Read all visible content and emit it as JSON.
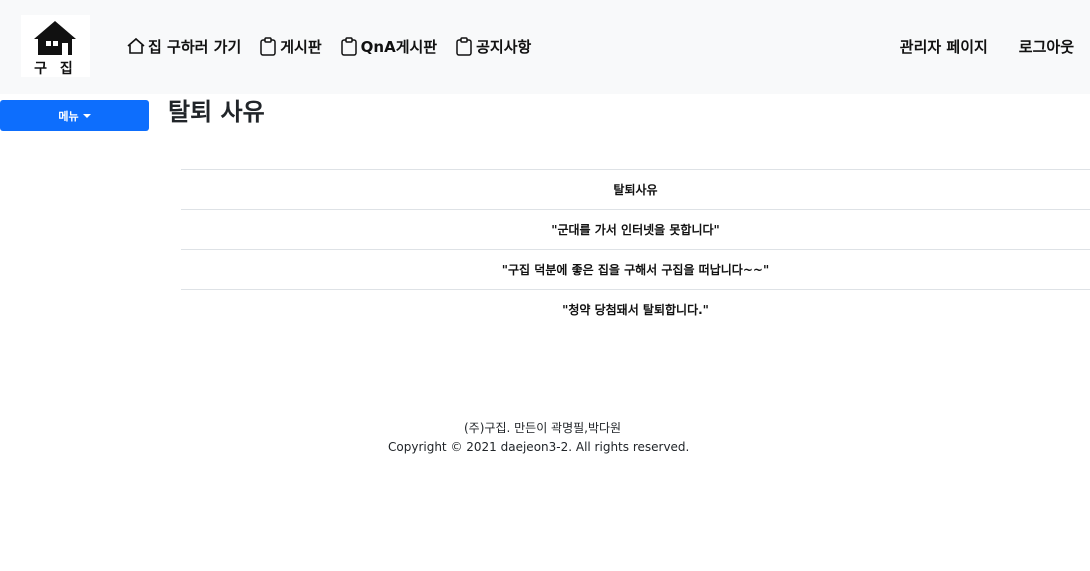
{
  "brand": {
    "logo_text": "구 집"
  },
  "nav": {
    "items": [
      {
        "label": "집 구하러 가기",
        "icon": "house-icon"
      },
      {
        "label": "게시판",
        "icon": "clipboard-icon"
      },
      {
        "label": "QnA게시판",
        "icon": "clipboard-icon"
      },
      {
        "label": "공지사항",
        "icon": "clipboard-icon"
      }
    ],
    "right": {
      "admin_label": "관리자 페이지",
      "logout_label": "로그아웃"
    }
  },
  "sidebar": {
    "menu_label": "메뉴"
  },
  "main": {
    "title": "탈퇴 사유",
    "table": {
      "header": "탈퇴사유",
      "rows": [
        "\"군대를 가서 인터넷을 못합니다\"",
        "\"구집 덕분에 좋은 집을 구해서 구집을 떠납니다~~\"",
        "\"청약 당첨돼서 탈퇴합니다.\""
      ]
    }
  },
  "footer": {
    "makers": "(주)구집. 만든이 곽명필,박다원",
    "copyright": "Copyright © 2021 daejeon3-2. All rights reserved."
  },
  "colors": {
    "navbar_bg": "#f8f9fa",
    "primary": "#0d6efd",
    "border": "#dee2e6"
  }
}
